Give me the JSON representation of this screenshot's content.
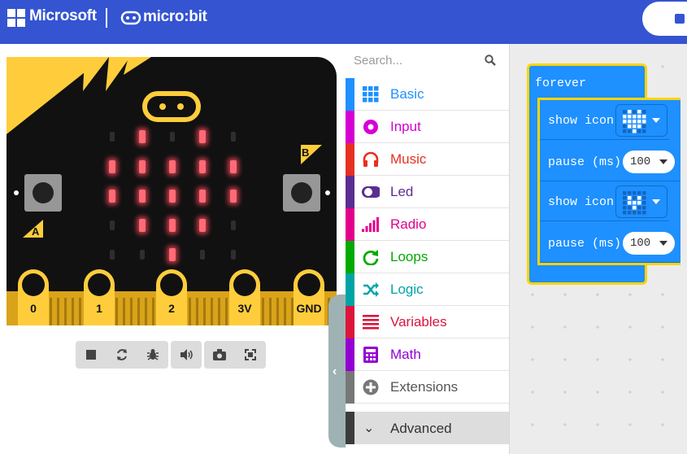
{
  "header": {
    "brand_text": "Microsoft",
    "product_text": "micro:bit",
    "accent": "#3454d1"
  },
  "simulator": {
    "button_a": "A",
    "button_b": "B",
    "pins": [
      "0",
      "1",
      "2",
      "3V",
      "GND"
    ],
    "led_matrix": [
      [
        0,
        1,
        0,
        1,
        0
      ],
      [
        1,
        1,
        1,
        1,
        1
      ],
      [
        1,
        1,
        1,
        1,
        1
      ],
      [
        0,
        1,
        1,
        1,
        0
      ],
      [
        0,
        0,
        1,
        0,
        0
      ]
    ],
    "controls": [
      "stop-icon",
      "restart-icon",
      "debug-icon",
      "sound-icon",
      "screenshot-icon",
      "fullscreen-icon"
    ]
  },
  "toolbox": {
    "search_placeholder": "Search...",
    "categories": [
      {
        "label": "Basic",
        "color": "#1e90ff",
        "icon": "grid-icon"
      },
      {
        "label": "Input",
        "color": "#d400d4",
        "icon": "target-icon"
      },
      {
        "label": "Music",
        "color": "#e63022",
        "icon": "headphones-icon"
      },
      {
        "label": "Led",
        "color": "#5c2d91",
        "icon": "toggle-icon"
      },
      {
        "label": "Radio",
        "color": "#e3008c",
        "icon": "signal-bars-icon"
      },
      {
        "label": "Loops",
        "color": "#00aa00",
        "icon": "loop-arrow-icon"
      },
      {
        "label": "Logic",
        "color": "#00a4a6",
        "icon": "shuffle-icon"
      },
      {
        "label": "Variables",
        "color": "#dc143c",
        "icon": "lines-icon"
      },
      {
        "label": "Math",
        "color": "#9400d3",
        "icon": "calculator-icon"
      },
      {
        "label": "Extensions",
        "color": "#777777",
        "icon": "plus-circle-icon"
      }
    ],
    "advanced_label": "Advanced"
  },
  "workspace": {
    "forever_label": "forever",
    "blocks": [
      {
        "label": "show icon",
        "type": "icon",
        "value": "heart"
      },
      {
        "label": "pause (ms)",
        "type": "number",
        "value": "100"
      },
      {
        "label": "show icon",
        "type": "icon",
        "value": "small-heart"
      },
      {
        "label": "pause (ms)",
        "type": "number",
        "value": "100"
      }
    ]
  }
}
